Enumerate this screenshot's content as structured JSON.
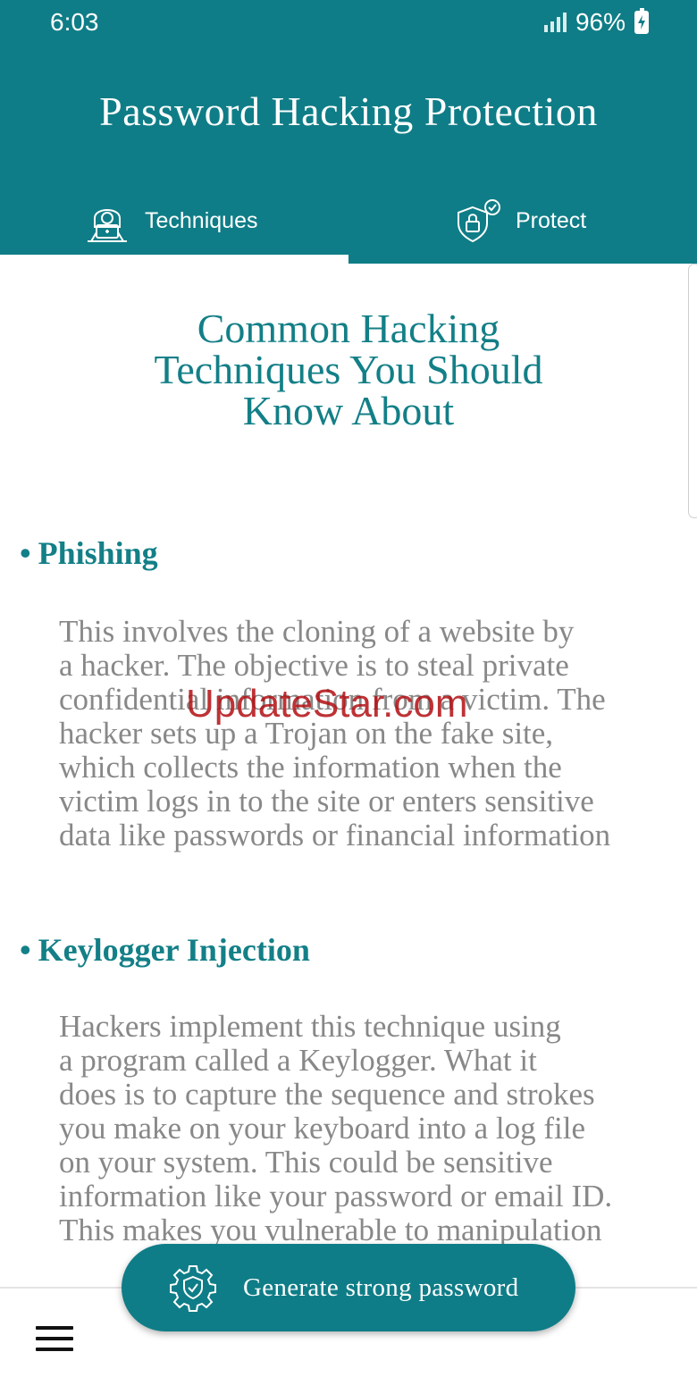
{
  "status_bar": {
    "time": "6:03",
    "battery": "96%"
  },
  "app_bar": {
    "title": "Password Hacking Protection",
    "color": "#0f7d87"
  },
  "tabs": [
    {
      "label": "Techniques",
      "icon": "hacker-icon",
      "selected": true
    },
    {
      "label": "Protect",
      "icon": "shield-lock-icon",
      "selected": false
    }
  ],
  "content": {
    "heading_lines": [
      "Common Hacking",
      "Techniques You Should",
      "Know About"
    ],
    "sections": [
      {
        "title": "Phishing",
        "body_lines": [
          "This involves the cloning of a website by",
          "a hacker. The objective is to steal private",
          "confidential information from a victim. The",
          "hacker sets up a Trojan on the fake site,",
          "which collects the information when the",
          "victim logs in to the site or enters sensitive",
          "data like passwords or financial information"
        ]
      },
      {
        "title": "Keylogger Injection",
        "body_lines": [
          "Hackers implement this technique using",
          "a program called a Keylogger. What it",
          "does is to capture the sequence and strokes",
          "you make on your keyboard into a log file",
          "on your system. This could be sensitive",
          "information like your password or email ID.",
          "This makes you vulnerable to manipulation"
        ]
      }
    ]
  },
  "watermark": "UpdateStar.com",
  "fab": {
    "label": "Generate strong password",
    "icon": "gear-shield-icon"
  },
  "bottom_nav": {
    "icon": "menu-icon"
  }
}
